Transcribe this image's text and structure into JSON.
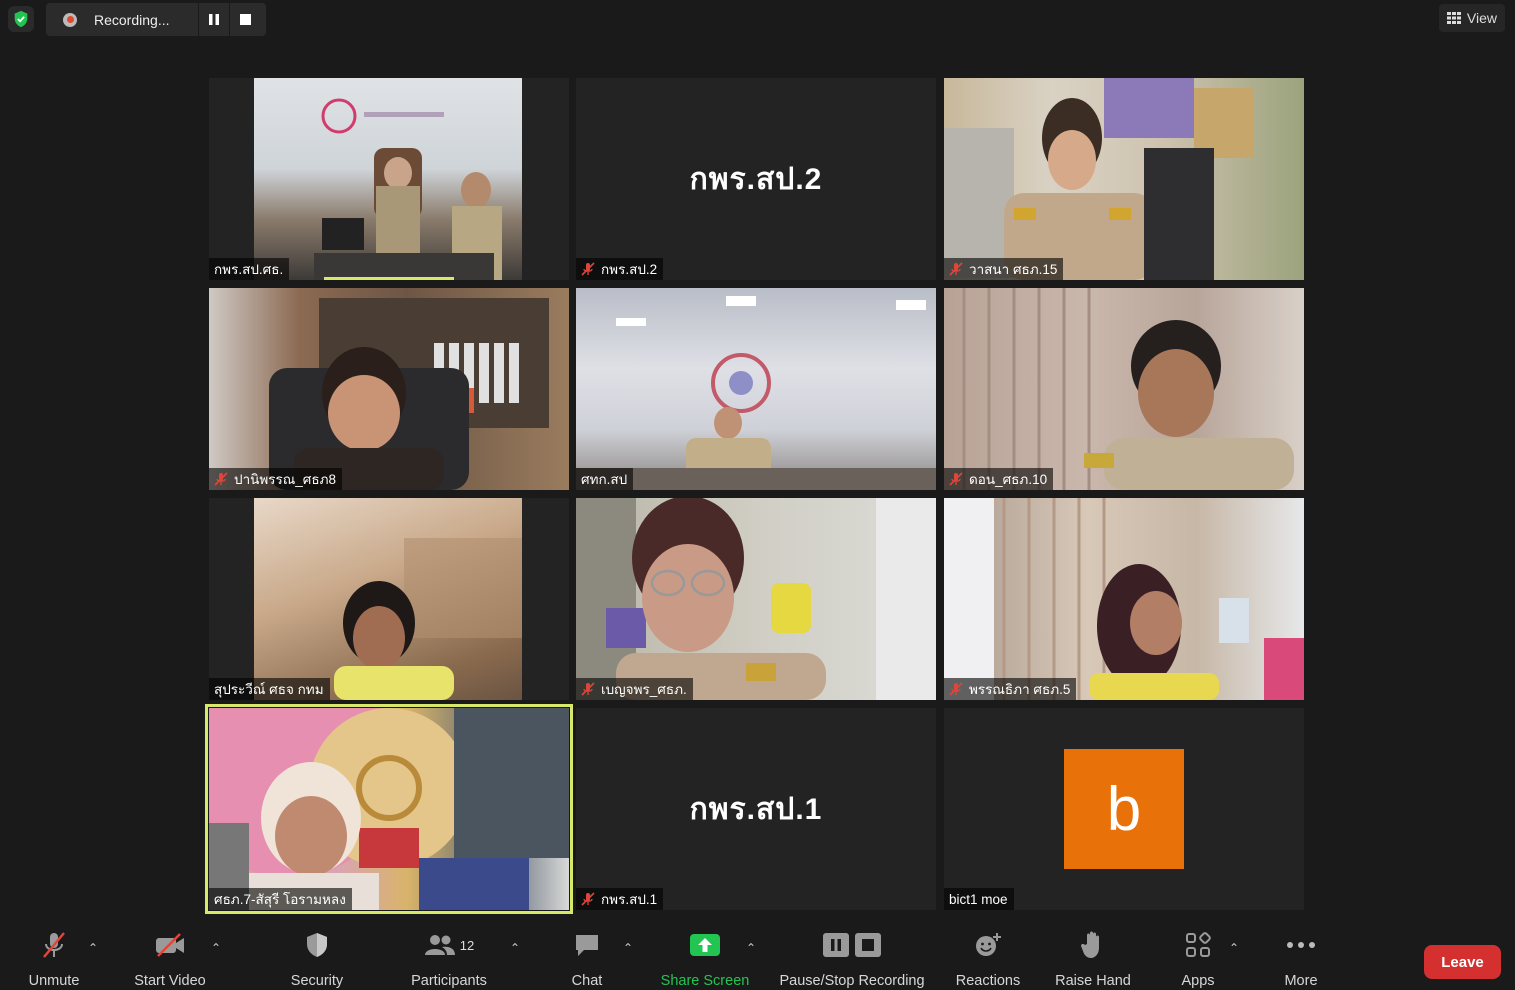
{
  "recording": {
    "label": "Recording..."
  },
  "view": {
    "label": "View"
  },
  "tiles": [
    {
      "name": "กพร.สป.ศธ.",
      "muted": false
    },
    {
      "name": "กพร.สป.2",
      "muted": true,
      "center_text": "กพร.สป.2"
    },
    {
      "name": "วาสนา ศธภ.15",
      "muted": true
    },
    {
      "name": "ปานิพรรณ_ศธภ8",
      "muted": true
    },
    {
      "name": "ศทก.สป",
      "muted": false
    },
    {
      "name": "ดอน_ศธภ.10",
      "muted": true
    },
    {
      "name": "สุประวีณ์ ศธจ กทม",
      "muted": false
    },
    {
      "name": "เบญจพร_ศธภ.",
      "muted": true
    },
    {
      "name": "พรรณธิภา ศธภ.5",
      "muted": true
    },
    {
      "name": "ศธภ.7-สัสุรี โอรามหลง",
      "muted": false
    },
    {
      "name": "กพร.สป.1",
      "muted": true,
      "center_text": "กพร.สป.1"
    },
    {
      "name": "bict1 moe",
      "muted": false,
      "avatar_letter": "b"
    }
  ],
  "toolbar": {
    "unmute": "Unmute",
    "start_video": "Start Video",
    "security": "Security",
    "participants": "Participants",
    "participants_count": "12",
    "chat": "Chat",
    "share_screen": "Share Screen",
    "pause_stop_recording": "Pause/Stop Recording",
    "reactions": "Reactions",
    "raise_hand": "Raise Hand",
    "apps": "Apps",
    "more": "More",
    "leave": "Leave"
  },
  "colors": {
    "share_green": "#23c552",
    "leave_red": "#d3302f",
    "active_speaker": "#d8e86a",
    "avatar_orange": "#e8710a",
    "muted_red": "#e0453a"
  }
}
